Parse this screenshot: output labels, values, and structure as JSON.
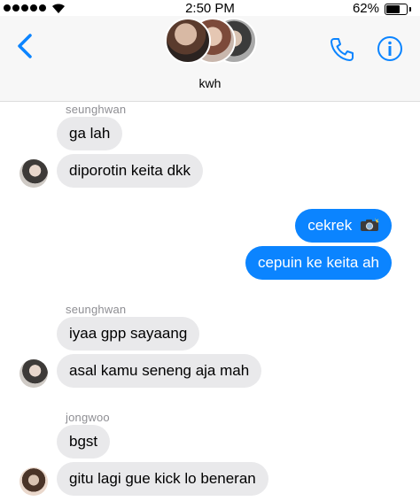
{
  "status_bar": {
    "time": "2:50 PM",
    "battery_percent": "62%",
    "battery_level": 0.62
  },
  "header": {
    "conversation_name": "kwh"
  },
  "messages": [
    {
      "sender": "seunghwan",
      "text": "ga lah",
      "direction": "incoming"
    },
    {
      "text": "diporotin keita dkk",
      "direction": "incoming"
    },
    {
      "text": "cekrek",
      "direction": "outgoing",
      "icon": "camera-flash-icon"
    },
    {
      "text": "cepuin ke keita ah",
      "direction": "outgoing"
    },
    {
      "sender": "seunghwan",
      "text": "iyaa gpp sayaang",
      "direction": "incoming"
    },
    {
      "text": "asal kamu seneng aja mah",
      "direction": "incoming"
    },
    {
      "sender": "jongwoo",
      "text": "bgst",
      "direction": "incoming"
    },
    {
      "text": "gitu lagi gue kick lo beneran",
      "direction": "incoming"
    }
  ],
  "colors": {
    "accent": "#0b84ff",
    "incoming_bubble": "#e9e9eb",
    "header_bg": "#f7f7f7",
    "sender_label": "#8e8e93"
  }
}
